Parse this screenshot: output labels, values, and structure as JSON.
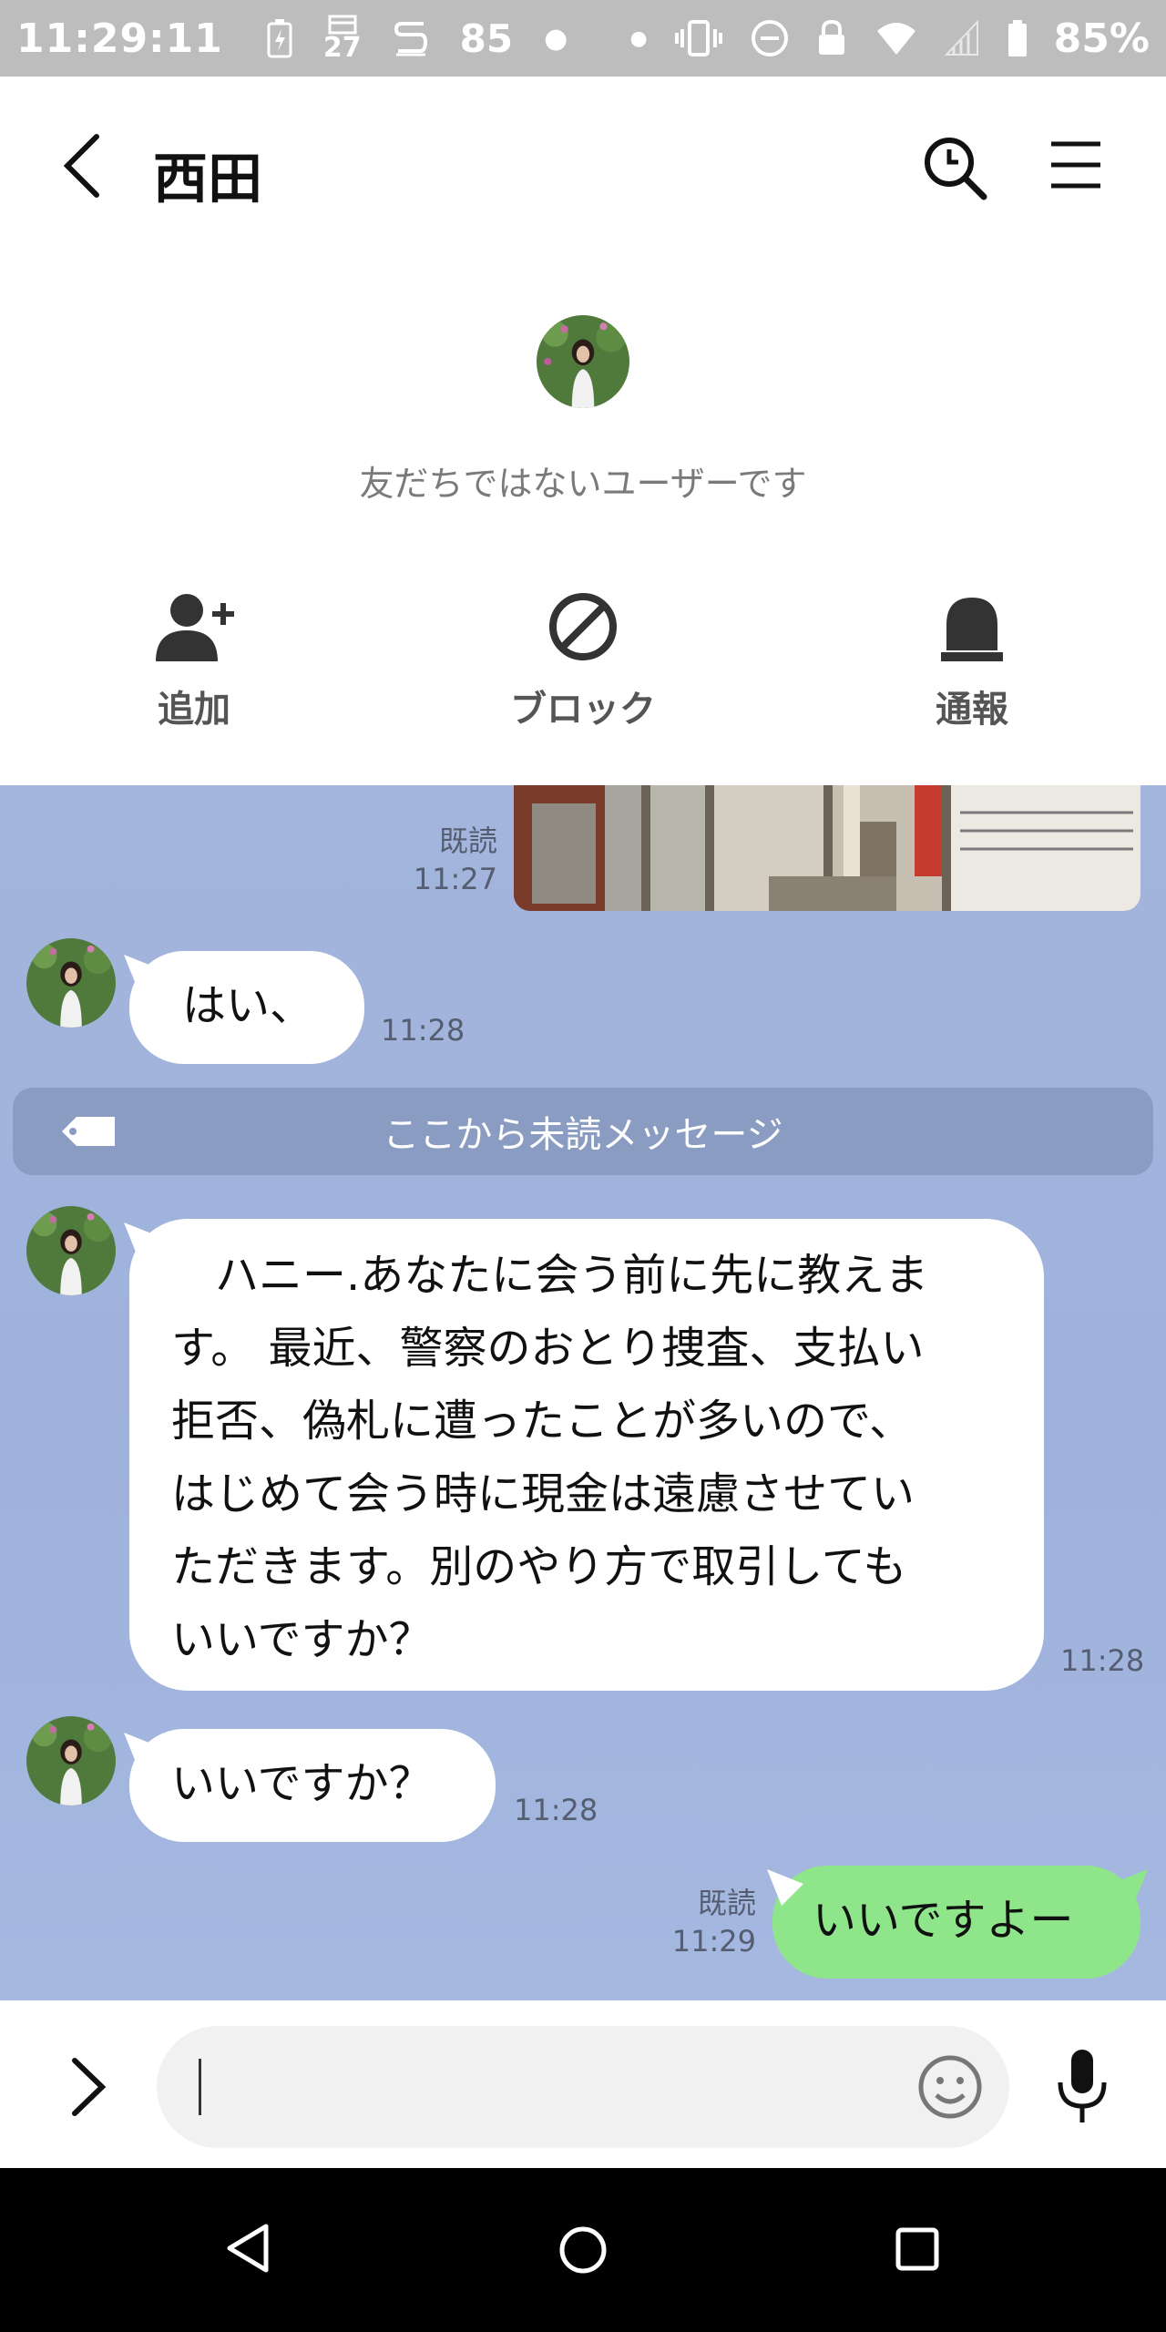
{
  "status_bar": {
    "time": "11:29:11",
    "notif_number_1": "27",
    "notif_number_2": "85",
    "battery": "85%"
  },
  "header": {
    "title": "西田",
    "back_icon": "chevron-left-icon",
    "search_icon": "search-icon",
    "menu_icon": "hamburger-menu-icon"
  },
  "friend_panel": {
    "notice": "友だちではないユーザーです",
    "actions": [
      {
        "label": "追加",
        "icon": "add-friend-icon"
      },
      {
        "label": "ブロック",
        "icon": "block-icon"
      },
      {
        "label": "通報",
        "icon": "report-icon"
      }
    ]
  },
  "chat": {
    "photo_message": {
      "read": "既読",
      "time": "11:27"
    },
    "messages": [
      {
        "sender": "other",
        "text": "はい、",
        "time": "11:28"
      },
      {
        "sender": "other",
        "lines": [
          "　ハニー.あなたに会う前に先に教えま",
          "す。 最近、警察のおとり捜査、支払い",
          "拒否、偽札に遭ったことが多いので、",
          "はじめて会う時に現金は遠慮させてい",
          "ただきます。別のやり方で取引しても",
          "いいですか？"
        ],
        "time": "11:28"
      },
      {
        "sender": "other",
        "text": "いいですか？",
        "time": "11:28"
      },
      {
        "sender": "me",
        "text": "いいですよー",
        "read": "既読",
        "time": "11:29"
      }
    ],
    "unread_divider": "ここから未読メッセージ"
  },
  "input_bar": {
    "placeholder": "",
    "emoji_icon": "emoji-icon",
    "mic_icon": "microphone-icon",
    "expand_icon": "chevron-right-icon"
  },
  "colors": {
    "chat_bg": "#a3b5dc",
    "my_bubble": "#8ee58a",
    "unread_bar": "#8a9cc2"
  }
}
